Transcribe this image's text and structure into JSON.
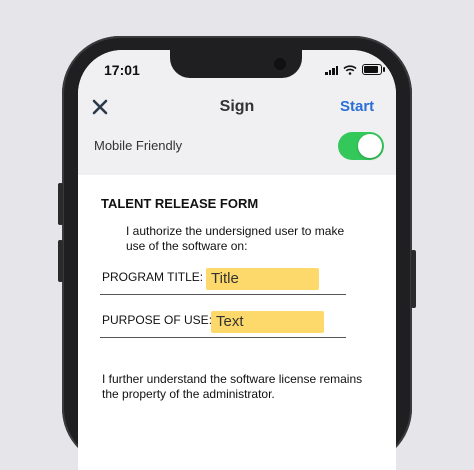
{
  "status_bar": {
    "time": "17:01",
    "icons": [
      "signal-icon",
      "wifi-icon",
      "battery-icon"
    ]
  },
  "nav": {
    "close_icon": "close-icon",
    "title": "Sign",
    "start_label": "Start"
  },
  "settings": {
    "mobile_friendly_label": "Mobile Friendly",
    "mobile_friendly_on": true
  },
  "form": {
    "title": "TALENT RELEASE FORM",
    "intro": "I authorize the undersigned user to make use of the software on:",
    "program_title_label": "PROGRAM TITLE:",
    "program_title_value": "Title",
    "purpose_label": "PURPOSE OF USE:",
    "purpose_value": "Text",
    "footer": "I further understand the software license remains the property of the administrator."
  },
  "colors": {
    "accent": "#2a6fd6",
    "toggle_on": "#34c759",
    "field_highlight": "#fcd96a"
  }
}
